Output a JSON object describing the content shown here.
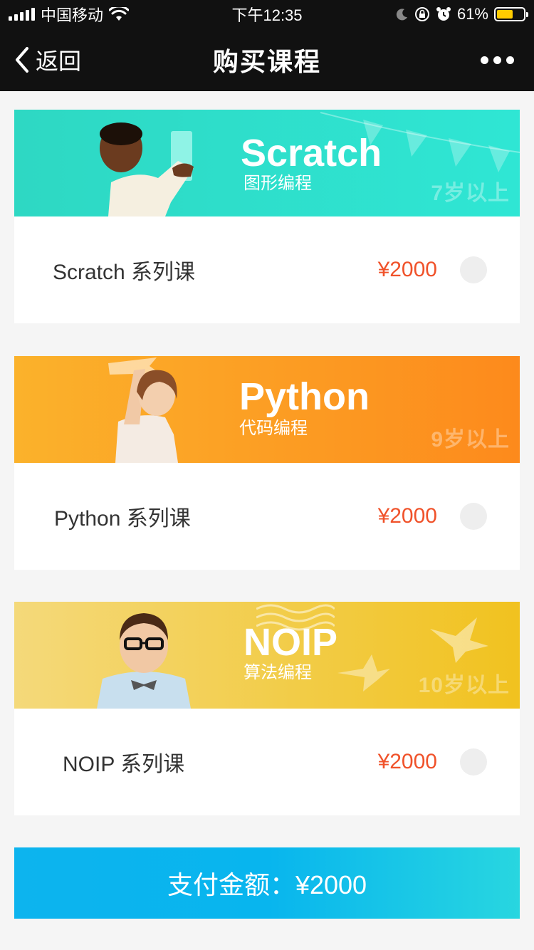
{
  "status_bar": {
    "carrier": "中国移动",
    "time": "下午12:35",
    "battery_percent": "61%",
    "battery_level": 0.61
  },
  "nav": {
    "back_label": "返回",
    "title": "购买课程"
  },
  "courses": [
    {
      "banner_title": "Scratch",
      "banner_subtitle": "图形编程",
      "age": "7岁以上",
      "name": "Scratch 系列课",
      "price": "¥2000",
      "selected": false,
      "banner_color_start": "#2ed8c3",
      "banner_color_end": "#2fe6d4"
    },
    {
      "banner_title": "Python",
      "banner_subtitle": "代码编程",
      "age": "9岁以上",
      "name": "Python 系列课",
      "price": "¥2000",
      "selected": false,
      "banner_color_start": "#fbb22b",
      "banner_color_end": "#fd8a1c"
    },
    {
      "banner_title": "NOIP",
      "banner_subtitle": "算法编程",
      "age": "10岁以上",
      "name": "NOIP 系列课",
      "price": "¥2000",
      "selected": false,
      "banner_color_start": "#f4d97a",
      "banner_color_end": "#f1c21f"
    }
  ],
  "pay": {
    "label": "支付金额：¥2000"
  },
  "colors": {
    "price": "#f0522a",
    "pay_button": "#0db4ee",
    "nav_background": "#111111"
  }
}
